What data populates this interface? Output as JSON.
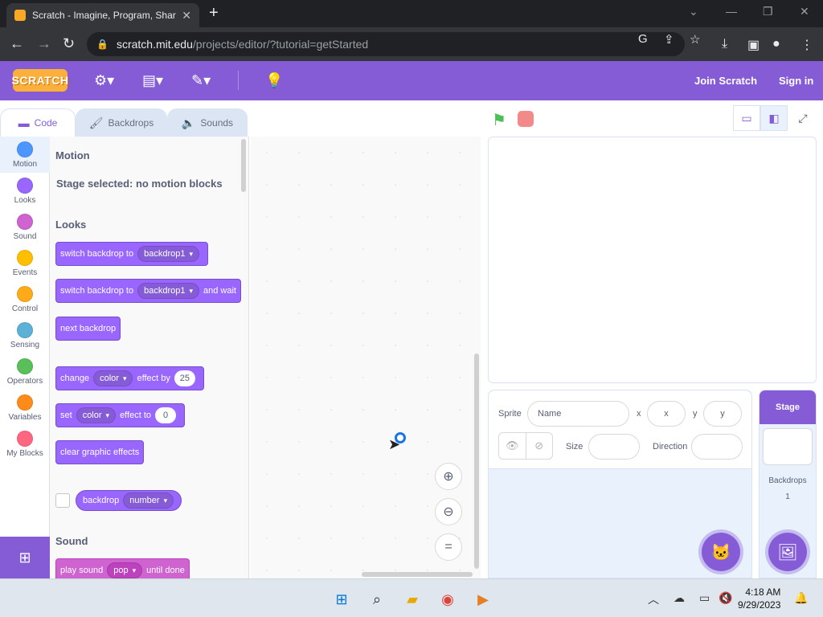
{
  "browser": {
    "tab_title": "Scratch - Imagine, Program, Shar",
    "url_host": "scratch.mit.edu",
    "url_path": "/projects/editor/?tutorial=getStarted"
  },
  "menubar": {
    "logo": "SCRATCH",
    "join": "Join Scratch",
    "signin": "Sign in"
  },
  "editor_tabs": [
    "Code",
    "Backdrops",
    "Sounds"
  ],
  "categories": [
    {
      "label": "Motion",
      "color": "#4c97ff"
    },
    {
      "label": "Looks",
      "color": "#9966ff"
    },
    {
      "label": "Sound",
      "color": "#cf63cf"
    },
    {
      "label": "Events",
      "color": "#ffbf00"
    },
    {
      "label": "Control",
      "color": "#ffab19"
    },
    {
      "label": "Sensing",
      "color": "#5cb1d6"
    },
    {
      "label": "Operators",
      "color": "#59c059"
    },
    {
      "label": "Variables",
      "color": "#ff8c1a"
    },
    {
      "label": "My Blocks",
      "color": "#ff6680"
    }
  ],
  "palette": {
    "motion_title": "Motion",
    "motion_note": "Stage selected: no motion blocks",
    "looks_title": "Looks",
    "sound_title": "Sound",
    "blocks": {
      "switch_backdrop": "switch backdrop to",
      "backdrop_dd": "backdrop1",
      "and_wait": "and wait",
      "next_backdrop": "next backdrop",
      "change": "change",
      "color_dd": "color",
      "effect_by": "effect by",
      "effect_by_val": "25",
      "set": "set",
      "effect_to": "effect to",
      "effect_to_val": "0",
      "clear_effects": "clear graphic effects",
      "backdrop_reporter": "backdrop",
      "number_dd": "number",
      "play_sound": "play sound",
      "pop_dd": "pop",
      "until_done": "until done"
    }
  },
  "sprite_info": {
    "sprite_label": "Sprite",
    "name_placeholder": "Name",
    "x_label": "x",
    "x_placeholder": "x",
    "y_label": "y",
    "y_placeholder": "y",
    "size_label": "Size",
    "direction_label": "Direction"
  },
  "stage_pane": {
    "title": "Stage",
    "backdrops_label": "Backdrops",
    "backdrops_count": "1"
  },
  "taskbar": {
    "time": "4:18 AM",
    "date": "9/29/2023"
  }
}
